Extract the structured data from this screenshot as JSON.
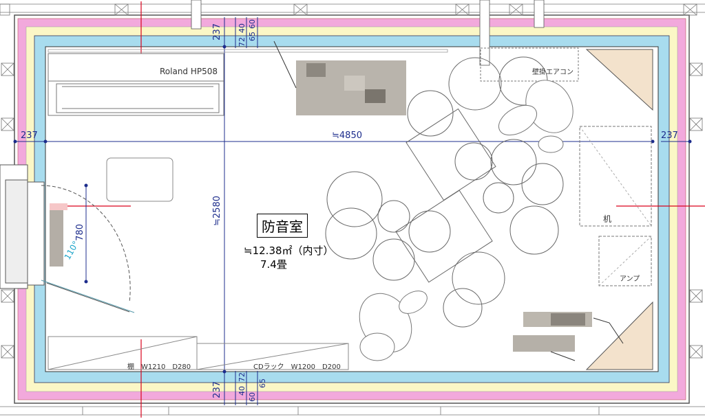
{
  "room": {
    "name": "防音室",
    "area": "≒12.38㎡（内寸）",
    "tatami": "7.4畳"
  },
  "dimensions": {
    "left_wall": "237",
    "right_wall": "237",
    "width": "≒4850",
    "height": "≒2580",
    "top_wall": "237",
    "top_d1": "72",
    "top_d2": "40",
    "top_d3": "65",
    "top_d4": "60",
    "bottom_wall": "237",
    "bottom_d1": "72",
    "bottom_d2": "40",
    "bottom_d3": "60",
    "bottom_d4": "65",
    "door_width": "780",
    "door_angle": "110°"
  },
  "furniture": {
    "piano": "Roland HP508",
    "aircon": "壁掛エアコン",
    "desk": "机",
    "amp": "アンプ",
    "shelf": "棚　W1210　D280",
    "cd_rack": "CDラック　W1200　D200"
  },
  "colors": {
    "pink_layer": "#f2a9dc",
    "yellow_layer": "#fbf7c6",
    "blue_layer": "#a8dcee",
    "dimension": "#1c2c8c",
    "redline": "#d9001b",
    "corner_fill": "#f3e2cc"
  }
}
